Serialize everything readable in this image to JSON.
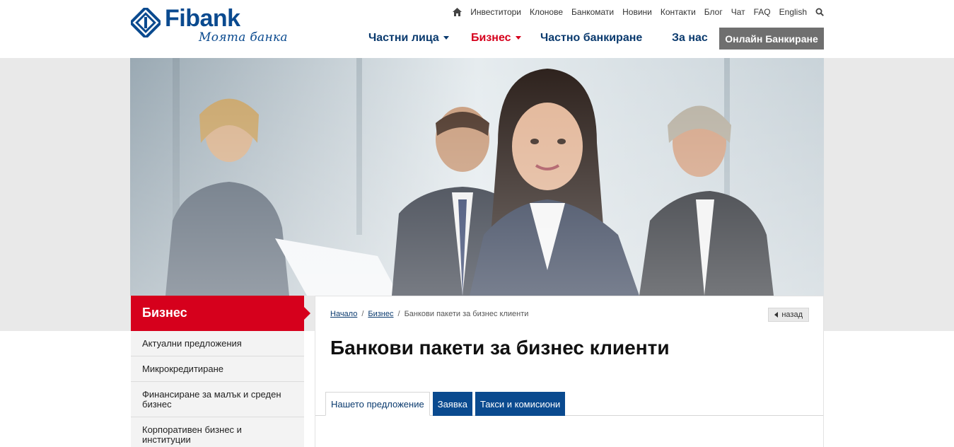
{
  "brand": {
    "name": "Fibank",
    "tagline": "Моята банка",
    "colors": {
      "primary": "#0a4a8f",
      "accent": "#d6001c",
      "online_button": "#6f6f6f"
    }
  },
  "topnav": {
    "home_icon": "home-icon",
    "items": [
      "Инвеститори",
      "Клонове",
      "Банкомати",
      "Новини",
      "Контакти",
      "Блог",
      "Чат",
      "FAQ",
      "English"
    ],
    "search_icon": "search-icon"
  },
  "mainnav": {
    "items": [
      {
        "label": "Частни лица",
        "has_dropdown": true,
        "active": false
      },
      {
        "label": "Бизнес",
        "has_dropdown": true,
        "active": true
      },
      {
        "label": "Частно банкиране",
        "has_dropdown": false,
        "active": false
      },
      {
        "label": "За нас",
        "has_dropdown": false,
        "active": false
      }
    ],
    "online_button": "Онлайн Банкиране"
  },
  "sidebar": {
    "title": "Бизнес",
    "items": [
      "Актуални предложения",
      "Микрокредитиране",
      "Финансиране за малък и среден бизнес",
      "Корпоративен бизнес и институции"
    ]
  },
  "content": {
    "breadcrumb": {
      "home": "Начало",
      "section": "Бизнес",
      "current": "Банкови пакети за бизнес клиенти"
    },
    "back_label": "назад",
    "title": "Банкови пакети за бизнес клиенти",
    "tabs": [
      "Нашето предложение",
      "Заявка",
      "Такси и комисиони"
    ],
    "active_tab": 0
  }
}
